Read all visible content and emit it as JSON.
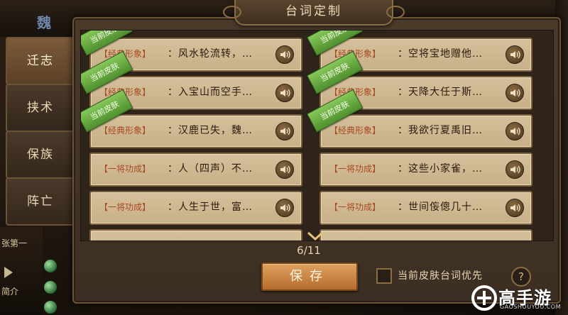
{
  "window_title": "台词定制",
  "faction_label": "魏",
  "side_tabs": [
    {
      "label": "迁志",
      "active": true
    },
    {
      "label": "挟术",
      "active": false
    },
    {
      "label": "保族",
      "active": false
    },
    {
      "label": "阵亡",
      "active": false
    }
  ],
  "background_text": {
    "left_1": "张第一",
    "left_2": "简介"
  },
  "ribbon_text": "当前皮肤",
  "lines_left": [
    {
      "tag": "【经典形象】",
      "text": "：风水轮流转，…",
      "ribbon": true
    },
    {
      "tag": "【经典形象】",
      "text": "：入宝山而空手…",
      "ribbon": true
    },
    {
      "tag": "【经典形象】",
      "text": "：汉鹿已失，魏…",
      "ribbon": true
    },
    {
      "tag": "【一将功成】",
      "text": "：人（四声）不…",
      "ribbon": false
    },
    {
      "tag": "【一将功成】",
      "text": "：人生于世，富…",
      "ribbon": false
    }
  ],
  "lines_right": [
    {
      "tag": "【经典形象】",
      "text": "：空将宝地赠他…",
      "ribbon": true
    },
    {
      "tag": "【经典形象】",
      "text": "：天降大任于斯…",
      "ribbon": true
    },
    {
      "tag": "【经典形象】",
      "text": "：我欲行夏禹旧…",
      "ribbon": true
    },
    {
      "tag": "【一将功成】",
      "text": "：这些小家雀，…",
      "ribbon": false
    },
    {
      "tag": "【一将功成】",
      "text": "：世间侫傯几十…",
      "ribbon": false
    }
  ],
  "page_indicator": "6/11",
  "save_label": "保存",
  "prefer_skin_label": "当前皮肤台词优先",
  "prefer_skin_checked": false,
  "help_label": "?",
  "watermark": {
    "main": "高手游",
    "sub": "GAOSHOUYOU.COM"
  },
  "colors": {
    "accent": "#b56c2e",
    "ribbon": "#4f8f2e",
    "tag": "#a84a20"
  }
}
